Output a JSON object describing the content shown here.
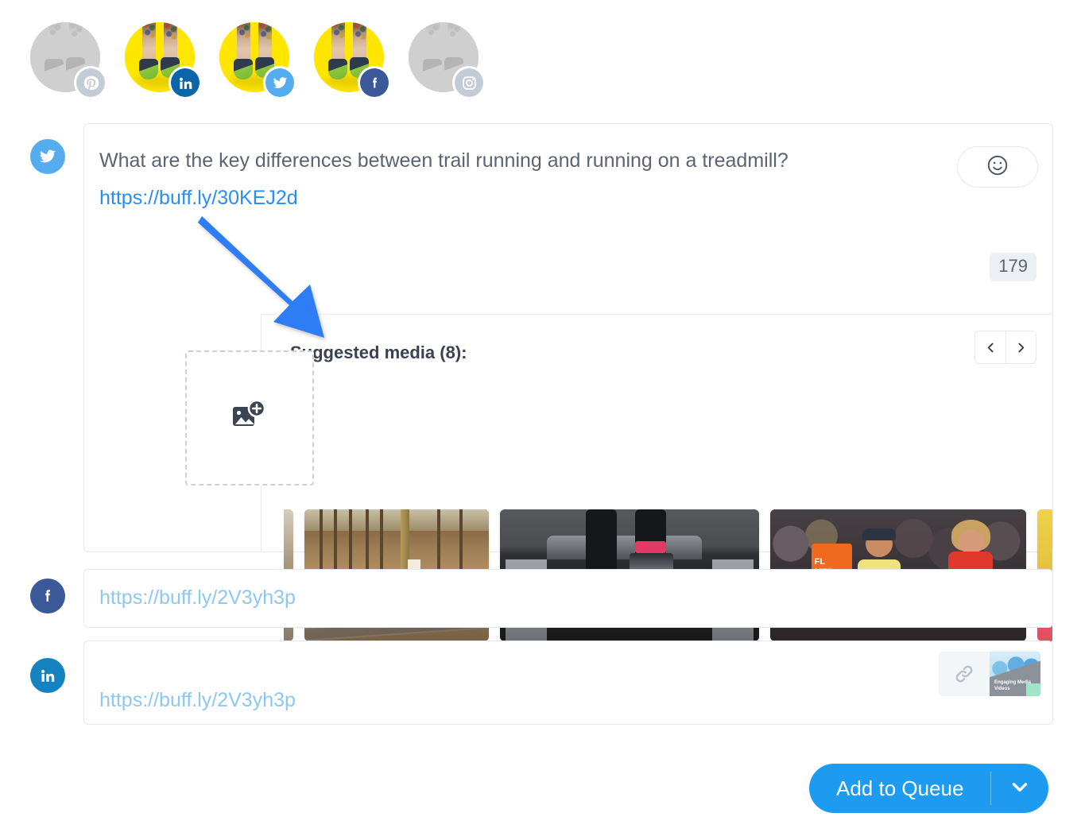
{
  "profiles": [
    {
      "network": "pinterest",
      "icon": "pinterest-icon",
      "enabled": false
    },
    {
      "network": "linkedin",
      "icon": "linkedin-icon",
      "enabled": true
    },
    {
      "network": "twitter",
      "icon": "twitter-icon",
      "enabled": true
    },
    {
      "network": "facebook",
      "icon": "facebook-icon",
      "enabled": true
    },
    {
      "network": "instagram",
      "icon": "instagram-icon",
      "enabled": false
    }
  ],
  "twitter_card": {
    "network": "twitter",
    "message": "What are the key differences between trail running and running on a treadmill?",
    "link": "https://buff.ly/30KEJ2d",
    "char_count": "179",
    "emoji_button_icon": "smiley-icon",
    "media": {
      "title": "Suggested media (8):",
      "count": 8,
      "prev_icon": "chevron-left-icon",
      "next_icon": "chevron-right-icon",
      "upload_icon": "add-image-icon",
      "thumbnails": [
        {
          "alt": "partial-image-left"
        },
        {
          "alt": "two runners on a forest trail in autumn"
        },
        {
          "alt": "running shoes on a treadmill"
        },
        {
          "alt": "two female marathon runners with race bibs"
        },
        {
          "alt": "partial-image-right"
        }
      ]
    }
  },
  "facebook_card": {
    "network": "facebook",
    "link": "https://buff.ly/2V3yh3p"
  },
  "linkedin_card": {
    "network": "linkedin",
    "link": "https://buff.ly/2V3yh3p",
    "attachment": {
      "link_icon": "link-icon",
      "thumb_text": "Engaging Media Videos"
    }
  },
  "footer": {
    "primary_label": "Add to Queue",
    "dropdown_icon": "chevron-down-icon"
  },
  "annotation": {
    "type": "arrow",
    "color": "#2f7df4"
  },
  "colors": {
    "accent": "#1d9bf0",
    "twitter": "#55acee",
    "facebook": "#3b5998",
    "linkedin": "#1583c0",
    "disabled": "#c3cbd6",
    "link_text": "#2a8df2",
    "placeholder": "#8ec7f0"
  }
}
